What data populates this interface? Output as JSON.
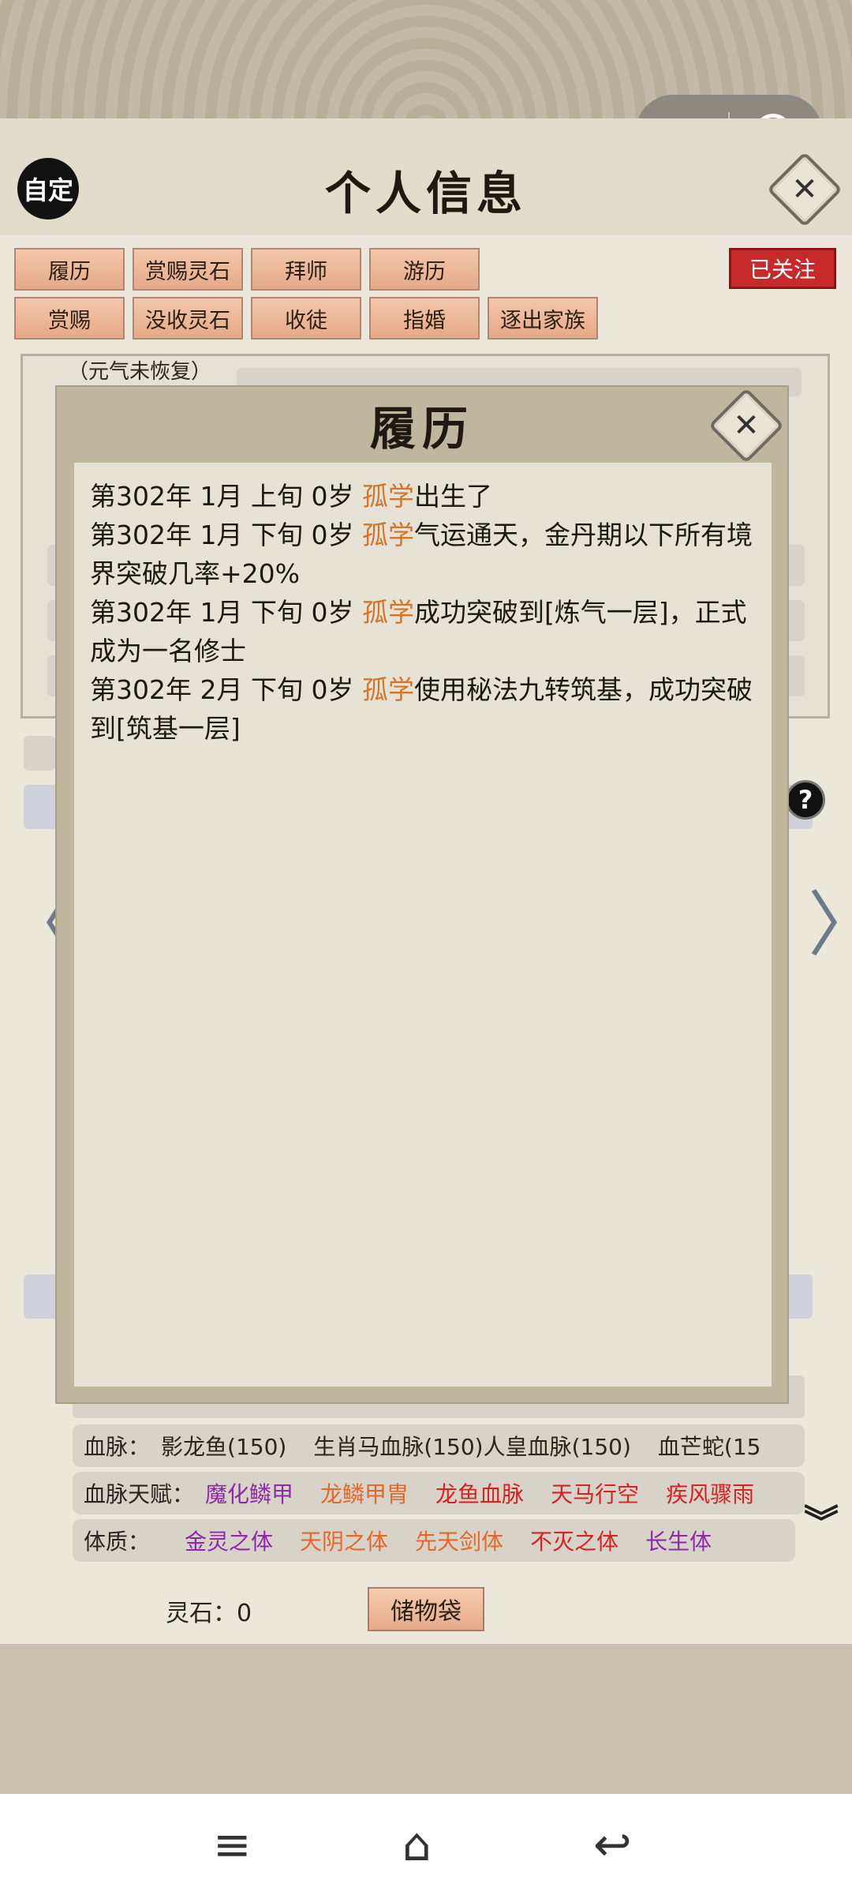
{
  "header": {
    "auto_label": "自定",
    "title": "个人信息",
    "close_glyph": "✕"
  },
  "capsule": {
    "more_glyph": "•••"
  },
  "tabs_row1": [
    "履历",
    "赏赐灵石",
    "拜师",
    "游历"
  ],
  "tabs_row2": [
    "赏赐",
    "没收灵石",
    "收徒",
    "指婚",
    "逐出家族"
  ],
  "followed_badge": "已关注",
  "vigor_note": "（元气未恢复）",
  "modal": {
    "title": "履历",
    "close_glyph": "✕",
    "entries": [
      {
        "prefix": "第302年 1月 上旬  0岁  ",
        "name": "孤学",
        "text": "出生了"
      },
      {
        "prefix": "第302年 1月 下旬  0岁  ",
        "name": "孤学",
        "text": "气运通天，金丹期以下所有境界突破几率+20%"
      },
      {
        "prefix": "第302年 1月 下旬  0岁  ",
        "name": "孤学",
        "text": "成功突破到[炼气一层]，正式成为一名修士"
      },
      {
        "prefix": "第302年 2月 下旬  0岁  ",
        "name": "孤学",
        "text": "使用秘法九转筑基，成功突破到[筑基一层]"
      }
    ]
  },
  "info": {
    "bloodline_label": "血脉：",
    "bloodlines": [
      "影龙鱼(150)",
      "生肖马血脉(150)人皇血脉(150)",
      "血芒蛇(15"
    ],
    "bloodline_talent_label": "血脉天赋：",
    "bloodline_talents": [
      {
        "name": "魔化鳞甲",
        "color": "#8e2aa8"
      },
      {
        "name": "龙鳞甲胄",
        "color": "#e5672a"
      },
      {
        "name": "龙鱼血脉",
        "color": "#d62222"
      },
      {
        "name": "天马行空",
        "color": "#d62222"
      },
      {
        "name": "疾风骤雨",
        "color": "#d62222"
      }
    ],
    "physique_label": "体质：",
    "physiques": [
      {
        "name": "金灵之体",
        "color": "#8e2aa8"
      },
      {
        "name": "天阴之体",
        "color": "#e5672a"
      },
      {
        "name": "先天剑体",
        "color": "#e5672a"
      },
      {
        "name": "不灭之体",
        "color": "#d62222"
      },
      {
        "name": "长生体",
        "color": "#8e2aa8"
      }
    ]
  },
  "footer": {
    "spirit_stone": "灵石：0",
    "storage_label": "储物袋"
  },
  "nav": {
    "left_glyph": "〈",
    "right_glyph": "〉",
    "help_glyph": "?"
  },
  "system_nav": {
    "menu_glyph": "≡",
    "home_glyph": "⌂",
    "back_glyph": "↩"
  },
  "expand_glyph": "︾"
}
